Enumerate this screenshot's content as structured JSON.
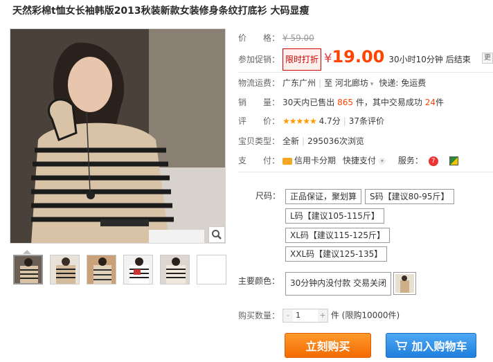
{
  "product": {
    "title": "天然彩棉t恤女长袖韩版2013秋装新款女装修身条纹打底衫 大码显瘦"
  },
  "price": {
    "label": "价　　格：",
    "original": "¥ 59.00"
  },
  "promo": {
    "label": "参加促销：",
    "tag": "限时打折",
    "currency": "¥",
    "price": "19.00",
    "countdown": "30小时10分钟 后结束",
    "more": "更多"
  },
  "shipping": {
    "label": "物流运费：",
    "from": "广东广州",
    "to": "至 河北廊坊",
    "express": "快递: 免运费"
  },
  "sales": {
    "label": "销　　量：",
    "prefix": "30天内已售出",
    "sold": "865",
    "mid": "件，其中交易成功",
    "success": "24",
    "suffix": "件"
  },
  "rating": {
    "label": "评　　价：",
    "stars": "★★★★★",
    "score": "4.7分",
    "reviews": "37条评价"
  },
  "item_type": {
    "label": "宝贝类型：",
    "condition": "全新",
    "views": "295036次浏览"
  },
  "payment": {
    "label": "支　　付：",
    "credit": "信用卡分期",
    "fast": "快捷支付",
    "service_label": "服务："
  },
  "size": {
    "label": "尺码：",
    "options": [
      "正品保证，聚划算",
      "S码【建议80-95斤】",
      "L码【建议105-115斤】",
      "XL码【建议115-125斤】",
      "XXL码【建议125-135】"
    ]
  },
  "color": {
    "label": "主要颜色：",
    "option": "30分钟内没付款 交易关闭"
  },
  "quantity": {
    "label": "购买数量：",
    "minus": "-",
    "value": "1",
    "plus": "+",
    "unit": "件 (限购10000件)"
  },
  "buttons": {
    "buy_now": "立刻购买",
    "add_cart": "加入购物车"
  },
  "colors": {
    "price": "#ff4400",
    "buy_button": "#f36b00",
    "cart_button": "#1f7fdc"
  }
}
